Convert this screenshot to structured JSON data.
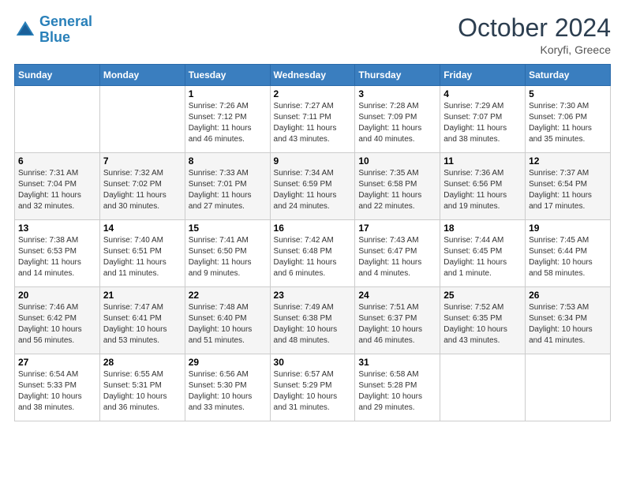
{
  "logo": {
    "line1": "General",
    "line2": "Blue"
  },
  "title": {
    "month_year": "October 2024",
    "location": "Koryfi, Greece"
  },
  "header_days": [
    "Sunday",
    "Monday",
    "Tuesday",
    "Wednesday",
    "Thursday",
    "Friday",
    "Saturday"
  ],
  "weeks": [
    [
      {
        "day": "",
        "content": ""
      },
      {
        "day": "",
        "content": ""
      },
      {
        "day": "1",
        "content": "Sunrise: 7:26 AM\nSunset: 7:12 PM\nDaylight: 11 hours and 46 minutes."
      },
      {
        "day": "2",
        "content": "Sunrise: 7:27 AM\nSunset: 7:11 PM\nDaylight: 11 hours and 43 minutes."
      },
      {
        "day": "3",
        "content": "Sunrise: 7:28 AM\nSunset: 7:09 PM\nDaylight: 11 hours and 40 minutes."
      },
      {
        "day": "4",
        "content": "Sunrise: 7:29 AM\nSunset: 7:07 PM\nDaylight: 11 hours and 38 minutes."
      },
      {
        "day": "5",
        "content": "Sunrise: 7:30 AM\nSunset: 7:06 PM\nDaylight: 11 hours and 35 minutes."
      }
    ],
    [
      {
        "day": "6",
        "content": "Sunrise: 7:31 AM\nSunset: 7:04 PM\nDaylight: 11 hours and 32 minutes."
      },
      {
        "day": "7",
        "content": "Sunrise: 7:32 AM\nSunset: 7:02 PM\nDaylight: 11 hours and 30 minutes."
      },
      {
        "day": "8",
        "content": "Sunrise: 7:33 AM\nSunset: 7:01 PM\nDaylight: 11 hours and 27 minutes."
      },
      {
        "day": "9",
        "content": "Sunrise: 7:34 AM\nSunset: 6:59 PM\nDaylight: 11 hours and 24 minutes."
      },
      {
        "day": "10",
        "content": "Sunrise: 7:35 AM\nSunset: 6:58 PM\nDaylight: 11 hours and 22 minutes."
      },
      {
        "day": "11",
        "content": "Sunrise: 7:36 AM\nSunset: 6:56 PM\nDaylight: 11 hours and 19 minutes."
      },
      {
        "day": "12",
        "content": "Sunrise: 7:37 AM\nSunset: 6:54 PM\nDaylight: 11 hours and 17 minutes."
      }
    ],
    [
      {
        "day": "13",
        "content": "Sunrise: 7:38 AM\nSunset: 6:53 PM\nDaylight: 11 hours and 14 minutes."
      },
      {
        "day": "14",
        "content": "Sunrise: 7:40 AM\nSunset: 6:51 PM\nDaylight: 11 hours and 11 minutes."
      },
      {
        "day": "15",
        "content": "Sunrise: 7:41 AM\nSunset: 6:50 PM\nDaylight: 11 hours and 9 minutes."
      },
      {
        "day": "16",
        "content": "Sunrise: 7:42 AM\nSunset: 6:48 PM\nDaylight: 11 hours and 6 minutes."
      },
      {
        "day": "17",
        "content": "Sunrise: 7:43 AM\nSunset: 6:47 PM\nDaylight: 11 hours and 4 minutes."
      },
      {
        "day": "18",
        "content": "Sunrise: 7:44 AM\nSunset: 6:45 PM\nDaylight: 11 hours and 1 minute."
      },
      {
        "day": "19",
        "content": "Sunrise: 7:45 AM\nSunset: 6:44 PM\nDaylight: 10 hours and 58 minutes."
      }
    ],
    [
      {
        "day": "20",
        "content": "Sunrise: 7:46 AM\nSunset: 6:42 PM\nDaylight: 10 hours and 56 minutes."
      },
      {
        "day": "21",
        "content": "Sunrise: 7:47 AM\nSunset: 6:41 PM\nDaylight: 10 hours and 53 minutes."
      },
      {
        "day": "22",
        "content": "Sunrise: 7:48 AM\nSunset: 6:40 PM\nDaylight: 10 hours and 51 minutes."
      },
      {
        "day": "23",
        "content": "Sunrise: 7:49 AM\nSunset: 6:38 PM\nDaylight: 10 hours and 48 minutes."
      },
      {
        "day": "24",
        "content": "Sunrise: 7:51 AM\nSunset: 6:37 PM\nDaylight: 10 hours and 46 minutes."
      },
      {
        "day": "25",
        "content": "Sunrise: 7:52 AM\nSunset: 6:35 PM\nDaylight: 10 hours and 43 minutes."
      },
      {
        "day": "26",
        "content": "Sunrise: 7:53 AM\nSunset: 6:34 PM\nDaylight: 10 hours and 41 minutes."
      }
    ],
    [
      {
        "day": "27",
        "content": "Sunrise: 6:54 AM\nSunset: 5:33 PM\nDaylight: 10 hours and 38 minutes."
      },
      {
        "day": "28",
        "content": "Sunrise: 6:55 AM\nSunset: 5:31 PM\nDaylight: 10 hours and 36 minutes."
      },
      {
        "day": "29",
        "content": "Sunrise: 6:56 AM\nSunset: 5:30 PM\nDaylight: 10 hours and 33 minutes."
      },
      {
        "day": "30",
        "content": "Sunrise: 6:57 AM\nSunset: 5:29 PM\nDaylight: 10 hours and 31 minutes."
      },
      {
        "day": "31",
        "content": "Sunrise: 6:58 AM\nSunset: 5:28 PM\nDaylight: 10 hours and 29 minutes."
      },
      {
        "day": "",
        "content": ""
      },
      {
        "day": "",
        "content": ""
      }
    ]
  ]
}
